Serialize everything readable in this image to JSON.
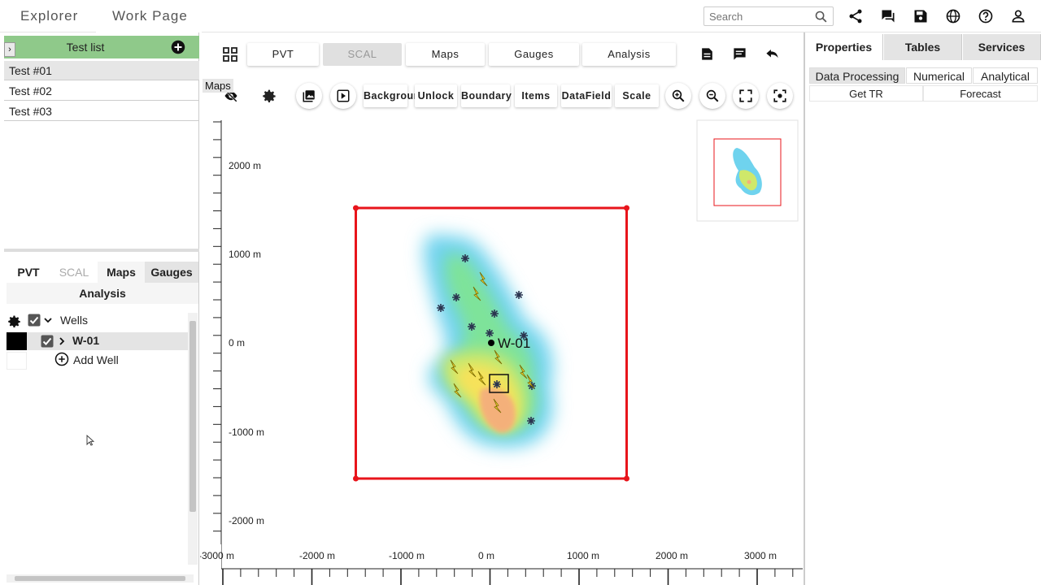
{
  "nav": {
    "explorer": "Explorer",
    "work_page": "Work Page"
  },
  "search": {
    "placeholder": "Search"
  },
  "top_icons": [
    "share-icon",
    "chat-icon",
    "save-icon",
    "globe-icon",
    "help-icon",
    "user-icon"
  ],
  "test_list": {
    "title": "Test list",
    "items": [
      "Test #01",
      "Test #02",
      "Test #03"
    ]
  },
  "left_tabs": {
    "pvt": "PVT",
    "scal": "SCAL",
    "maps": "Maps",
    "gauges": "Gauges",
    "analysis": "Analysis"
  },
  "wells_tree": {
    "group_label": "Wells",
    "well_label": "W-01",
    "add_label": "Add Well"
  },
  "center_tabs": {
    "pvt": "PVT",
    "scal": "SCAL",
    "maps": "Maps",
    "gauges": "Gauges",
    "analysis": "Analysis"
  },
  "map_toolbar": {
    "tooltip": "Maps",
    "background": "Background",
    "unlock": "Unlock",
    "boundary": "Boundary",
    "items": "Items",
    "datafield": "DataField",
    "scale": "Scale"
  },
  "map": {
    "well_label": "W-01",
    "y_ticks": [
      "2000 m",
      "1000 m",
      "0 m",
      "-1000 m",
      "-2000 m"
    ],
    "x_ticks": [
      "-3000 m",
      "-2000 m",
      "-1000 m",
      "0 m",
      "1000 m",
      "2000 m",
      "3000 m"
    ],
    "boundary_color": "#e8141b",
    "colormap": [
      "#6fd3ee",
      "#7ee39a",
      "#cfe86a",
      "#f6e25a",
      "#f4b07a"
    ]
  },
  "right_tabs": {
    "properties": "Properties",
    "tables": "Tables",
    "services": "Services"
  },
  "right_subtabs": {
    "data_processing": "Data Processing",
    "numerical": "Numerical",
    "analytical": "Analytical",
    "get_tr": "Get TR",
    "forecast": "Forecast"
  }
}
